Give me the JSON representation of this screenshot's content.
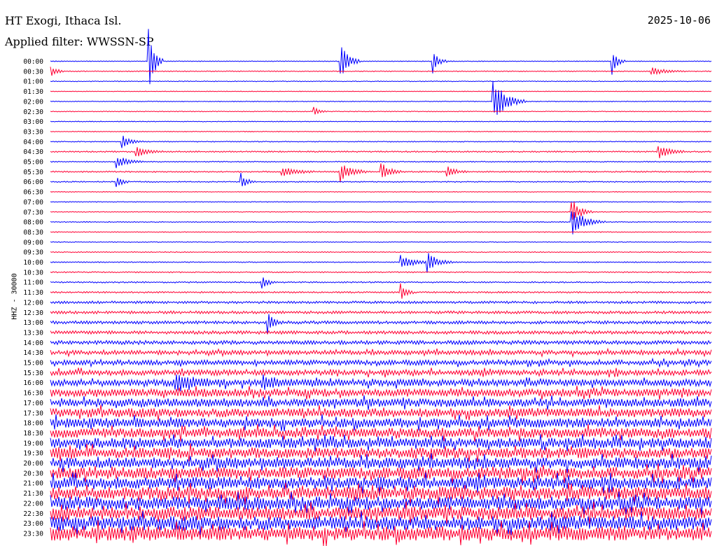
{
  "header": {
    "station": "HT Exogi, Ithaca Isl.",
    "filter": "Applied filter: WWSSN-SP",
    "date": "2025-10-06"
  },
  "chart_data": {
    "type": "line",
    "title": "HT Exogi, Ithaca Isl.",
    "subtitle": "Applied filter: WWSSN-SP",
    "ylabel": "HHZ - 30000",
    "row_labels": [
      "00:00",
      "00:30",
      "01:00",
      "01:30",
      "02:00",
      "02:30",
      "03:00",
      "03:30",
      "04:00",
      "04:30",
      "05:00",
      "05:30",
      "06:00",
      "06:30",
      "07:00",
      "07:30",
      "08:00",
      "08:30",
      "09:00",
      "09:30",
      "10:00",
      "10:30",
      "11:00",
      "11:30",
      "12:00",
      "12:30",
      "13:00",
      "13:30",
      "14:00",
      "14:30",
      "15:00",
      "15:30",
      "16:00",
      "16:30",
      "17:00",
      "17:30",
      "18:00",
      "18:30",
      "19:00",
      "19:30",
      "20:00",
      "20:30",
      "21:00",
      "21:30",
      "22:00",
      "22:30",
      "23:00",
      "23:30"
    ],
    "series_colors": [
      "#0000ff",
      "#ff0033"
    ],
    "row_noise_level": [
      0.3,
      0.35,
      0.3,
      0.25,
      0.3,
      0.3,
      0.3,
      0.3,
      0.35,
      0.5,
      0.4,
      0.5,
      0.4,
      0.3,
      0.3,
      0.3,
      0.35,
      0.35,
      0.3,
      0.35,
      0.4,
      0.45,
      0.5,
      0.6,
      0.9,
      1.0,
      1.1,
      1.2,
      1.4,
      1.6,
      1.8,
      2.0,
      2.4,
      2.8,
      3.0,
      3.2,
      3.4,
      3.5,
      3.6,
      3.8,
      4.0,
      4.2,
      4.4,
      4.6,
      4.7,
      4.8,
      5.0,
      5.2
    ],
    "events": [
      {
        "row": 0,
        "t": 0.15,
        "amp": 40,
        "dur": 0.02
      },
      {
        "row": 0,
        "t": 0.44,
        "amp": 22,
        "dur": 0.03
      },
      {
        "row": 0,
        "t": 0.58,
        "amp": 14,
        "dur": 0.02
      },
      {
        "row": 0,
        "t": 0.85,
        "amp": 18,
        "dur": 0.02
      },
      {
        "row": 1,
        "t": 0.0,
        "amp": 10,
        "dur": 0.02
      },
      {
        "row": 1,
        "t": 0.91,
        "amp": 6,
        "dur": 0.05
      },
      {
        "row": 4,
        "t": 0.67,
        "amp": 30,
        "dur": 0.05
      },
      {
        "row": 5,
        "t": 0.4,
        "amp": 6,
        "dur": 0.02
      },
      {
        "row": 8,
        "t": 0.11,
        "amp": 8,
        "dur": 0.03
      },
      {
        "row": 9,
        "t": 0.13,
        "amp": 8,
        "dur": 0.04
      },
      {
        "row": 9,
        "t": 0.92,
        "amp": 10,
        "dur": 0.04
      },
      {
        "row": 10,
        "t": 0.1,
        "amp": 10,
        "dur": 0.04
      },
      {
        "row": 11,
        "t": 0.35,
        "amp": 8,
        "dur": 0.05
      },
      {
        "row": 11,
        "t": 0.44,
        "amp": 14,
        "dur": 0.04
      },
      {
        "row": 11,
        "t": 0.5,
        "amp": 16,
        "dur": 0.03
      },
      {
        "row": 11,
        "t": 0.6,
        "amp": 8,
        "dur": 0.03
      },
      {
        "row": 12,
        "t": 0.1,
        "amp": 10,
        "dur": 0.02
      },
      {
        "row": 12,
        "t": 0.29,
        "amp": 10,
        "dur": 0.02
      },
      {
        "row": 15,
        "t": 0.79,
        "amp": 18,
        "dur": 0.03
      },
      {
        "row": 16,
        "t": 0.79,
        "amp": 18,
        "dur": 0.05
      },
      {
        "row": 20,
        "t": 0.53,
        "amp": 10,
        "dur": 0.05
      },
      {
        "row": 20,
        "t": 0.57,
        "amp": 14,
        "dur": 0.04
      },
      {
        "row": 22,
        "t": 0.32,
        "amp": 10,
        "dur": 0.02
      },
      {
        "row": 23,
        "t": 0.53,
        "amp": 14,
        "dur": 0.02
      },
      {
        "row": 26,
        "t": 0.33,
        "amp": 12,
        "dur": 0.02
      },
      {
        "row": 32,
        "t": 0.19,
        "amp": 10,
        "dur": 0.08
      },
      {
        "row": 32,
        "t": 0.32,
        "amp": 8,
        "dur": 0.06
      }
    ]
  }
}
